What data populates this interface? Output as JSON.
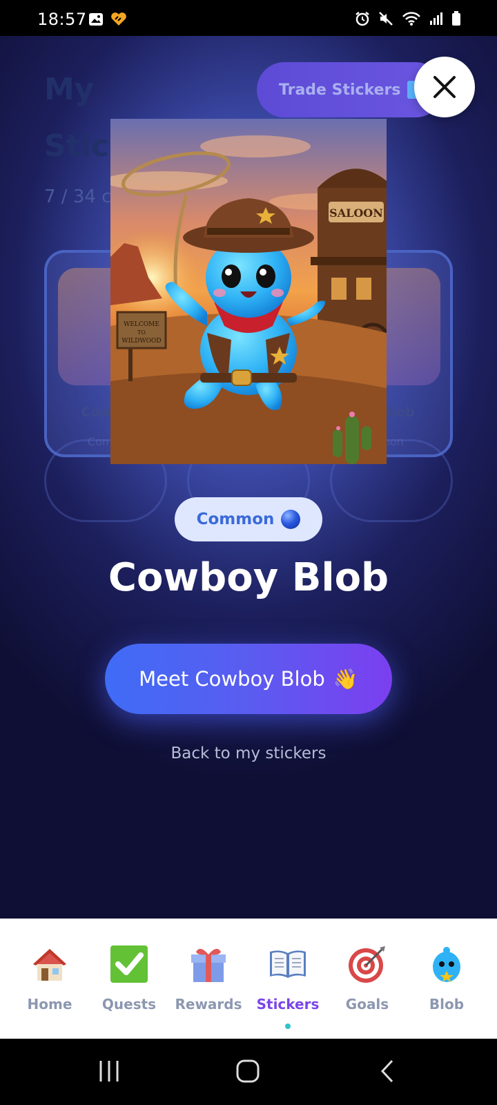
{
  "status_bar": {
    "time": "18:57"
  },
  "background_page": {
    "title_line1": "My",
    "title_line2": "Stic",
    "count_text": "7 / 34 c",
    "trade_button_label": "Trade Stickers",
    "card_left": {
      "name": "Cowbo",
      "rarity": "Comm"
    },
    "card_right": {
      "name": "n Blob",
      "rarity": "mon"
    }
  },
  "modal": {
    "rarity_label": "Common",
    "sticker_name": "Cowboy Blob",
    "meet_button_label": "Meet Cowboy Blob",
    "meet_button_emoji": "👋",
    "back_link": "Back to my stickers",
    "art_sign_text": "WELCOME TO WILDWOOD",
    "art_saloon_text": "SALOON"
  },
  "bottom_nav": {
    "items": [
      {
        "label": "Home",
        "icon": "house-icon"
      },
      {
        "label": "Quests",
        "icon": "checkmark-icon"
      },
      {
        "label": "Rewards",
        "icon": "gift-icon"
      },
      {
        "label": "Stickers",
        "icon": "open-book-icon"
      },
      {
        "label": "Goals",
        "icon": "target-icon"
      },
      {
        "label": "Blob",
        "icon": "blob-icon"
      }
    ],
    "active": "Stickers"
  },
  "colors": {
    "accent_purple": "#7b45e8",
    "nav_inactive": "#8c97b0",
    "rarity_blue": "#3a6ad8",
    "indicator_teal": "#2ec4c8"
  }
}
